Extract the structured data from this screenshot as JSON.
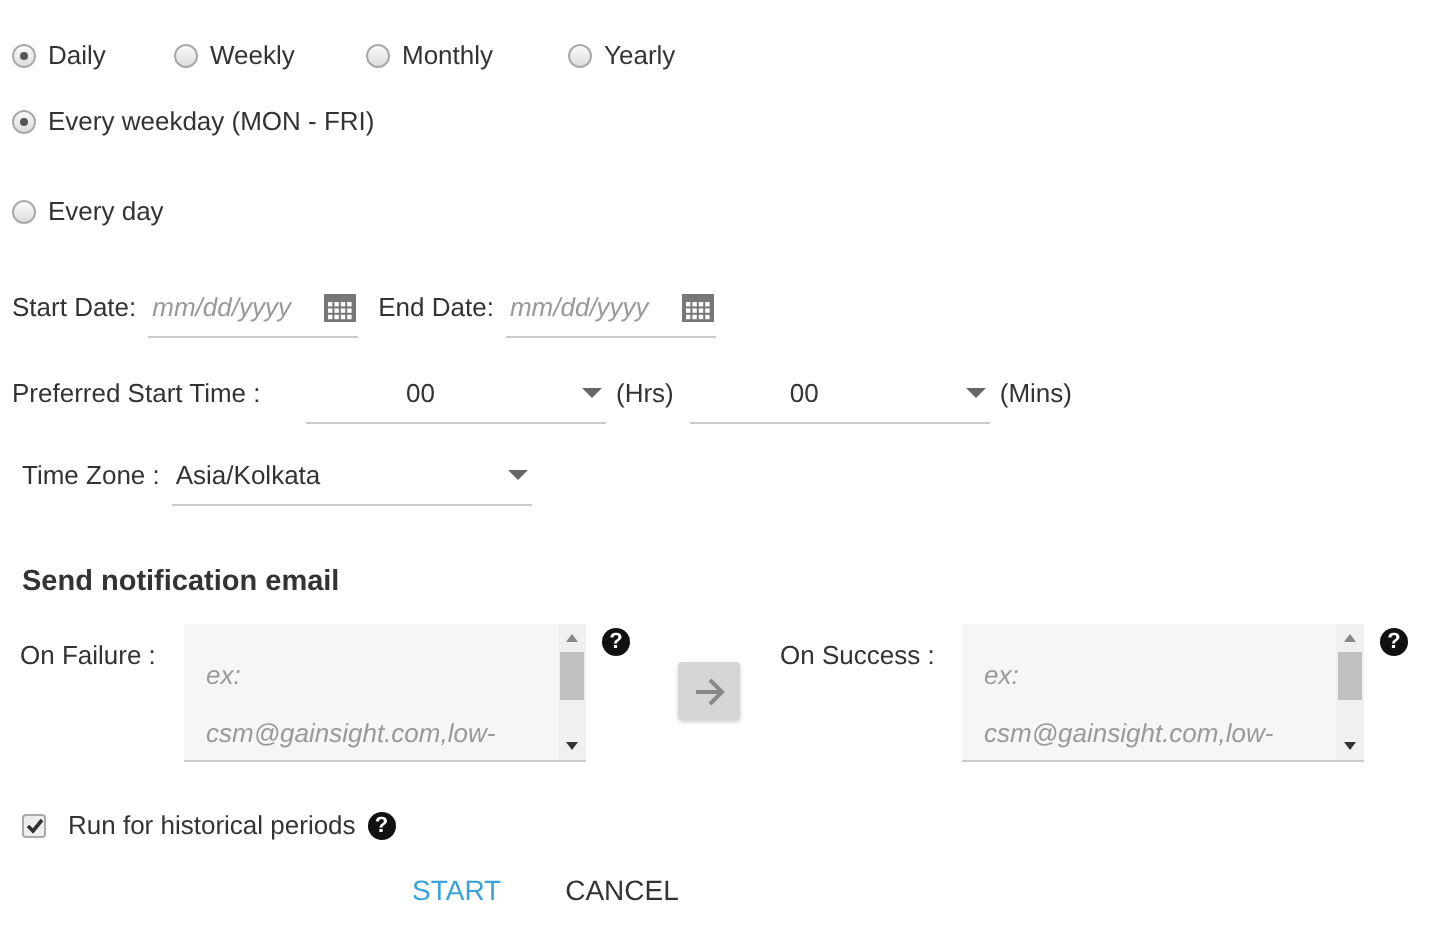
{
  "frequency": [
    {
      "label": "Daily",
      "selected": true
    },
    {
      "label": "Weekly",
      "selected": false
    },
    {
      "label": "Monthly",
      "selected": false
    },
    {
      "label": "Yearly",
      "selected": false
    }
  ],
  "daily_options": [
    {
      "label": "Every weekday (MON - FRI)",
      "selected": true
    },
    {
      "label": "Every day",
      "selected": false
    }
  ],
  "start_date": {
    "label": "Start Date:",
    "placeholder": "mm/dd/yyyy"
  },
  "end_date": {
    "label": "End Date:",
    "placeholder": "mm/dd/yyyy"
  },
  "start_time": {
    "label": "Preferred Start Time :",
    "hours": "00",
    "hours_unit": "(Hrs)",
    "minutes": "00",
    "minutes_unit": "(Mins)"
  },
  "time_zone": {
    "label": "Time Zone :",
    "value": "Asia/Kolkata"
  },
  "notification": {
    "heading": "Send notification email",
    "fields": [
      {
        "label": "On Failure :",
        "placeholder_lines": [
          "ex:",
          "csm@gainsight.com,low-"
        ],
        "help": "?"
      },
      {
        "label": "On Success :",
        "placeholder_lines": [
          "ex:",
          "csm@gainsight.com,low-"
        ],
        "help": "?"
      }
    ]
  },
  "historical": {
    "label": "Run for historical periods",
    "checked": true,
    "help": "?"
  },
  "buttons": [
    {
      "label": "START",
      "kind": "primary"
    },
    {
      "label": "CANCEL",
      "kind": "secondary"
    }
  ]
}
